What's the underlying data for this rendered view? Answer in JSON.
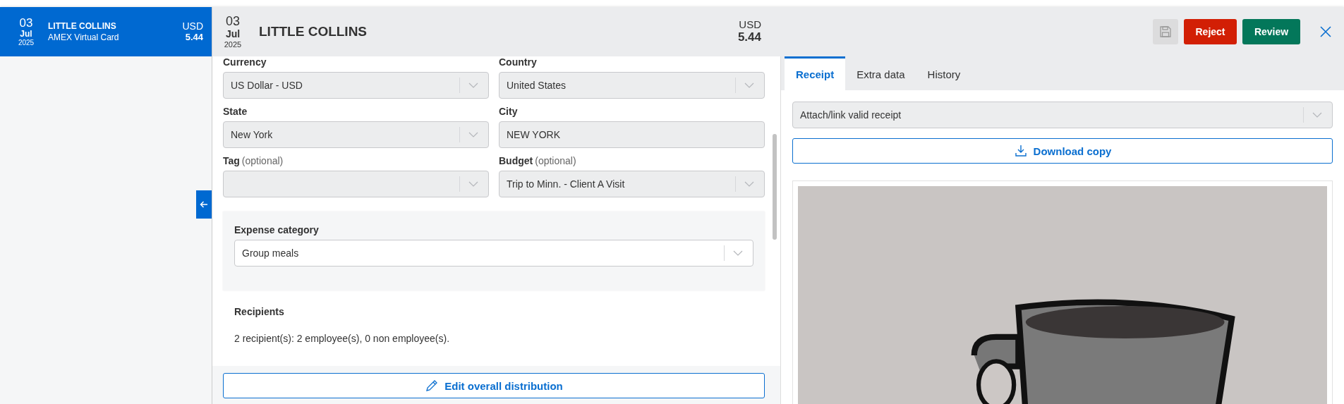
{
  "sidebar": {
    "items": [
      {
        "day": "03",
        "month": "Jul",
        "year": "2025",
        "merchant": "LITTLE COLLINS",
        "card": "AMEX Virtual Card",
        "currency": "USD",
        "amount": "5.44",
        "selected": true
      }
    ]
  },
  "header": {
    "day": "03",
    "month": "Jul",
    "year": "2025",
    "merchant": "LITTLE COLLINS",
    "currency": "USD",
    "amount": "5.44",
    "save_button": {
      "disabled": true
    },
    "actions": [
      {
        "label": "Reject",
        "kind": "danger"
      },
      {
        "label": "Review",
        "kind": "primary"
      }
    ]
  },
  "form": {
    "fields": [
      {
        "label": "Currency",
        "value": "US Dollar - USD",
        "kind": "select",
        "disabled": true
      },
      {
        "label": "Country",
        "value": "United States",
        "kind": "select",
        "disabled": true
      },
      {
        "label": "State",
        "value": "New York",
        "kind": "select",
        "disabled": true
      },
      {
        "label": "City",
        "value": "NEW YORK",
        "kind": "text",
        "disabled": true
      },
      {
        "label": "Tag",
        "optional": "(optional)",
        "kind": "select",
        "disabled": true
      },
      {
        "label": "Budget",
        "optional": "(optional)",
        "value": "Trip to Minn. - Client A Visit",
        "kind": "select",
        "disabled": true
      }
    ],
    "expense_category": {
      "label": "Expense category",
      "value": "Group meals",
      "disabled": false
    },
    "recipients": {
      "title": "Recipients",
      "summary": "2 recipient(s): 2 employee(s), 0 non employee(s)."
    },
    "footer_button": "Edit overall distribution"
  },
  "receipt_panel": {
    "tabs": [
      {
        "label": "Receipt",
        "selected": true
      },
      {
        "label": "Extra data",
        "selected": false
      },
      {
        "label": "History",
        "selected": false
      }
    ],
    "receipt_status": {
      "value": "Attach/link valid receipt",
      "disabled": true
    },
    "download_button": "Download copy"
  }
}
